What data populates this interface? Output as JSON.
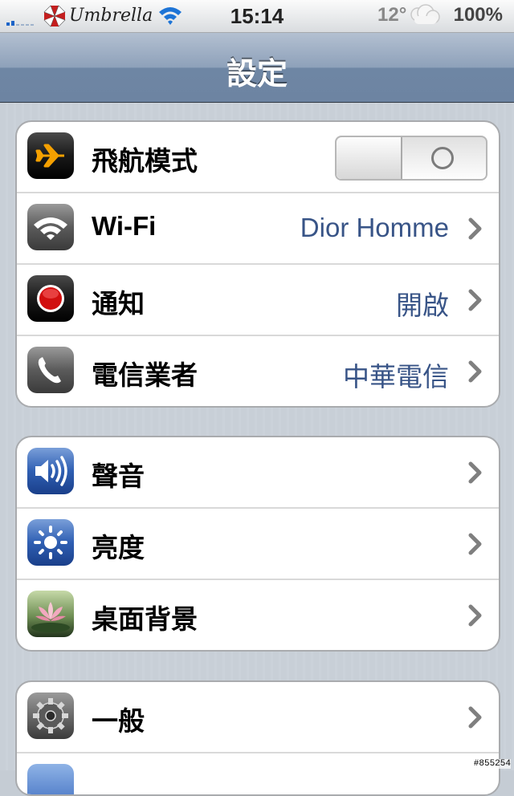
{
  "status_bar": {
    "carrier": "Umbrella",
    "time": "15:14",
    "temperature": "12°",
    "battery": "100%",
    "signal_bars": 2
  },
  "nav": {
    "title": "設定"
  },
  "groups": [
    {
      "rows": [
        {
          "icon": "airplane-icon",
          "label": "飛航模式",
          "toggle_state": "off"
        },
        {
          "icon": "wifi-icon",
          "label": "Wi-Fi",
          "value": "Dior Homme"
        },
        {
          "icon": "notification-icon",
          "label": "通知",
          "value": "開啟"
        },
        {
          "icon": "phone-icon",
          "label": "電信業者",
          "value": "中華電信"
        }
      ]
    },
    {
      "rows": [
        {
          "icon": "speaker-icon",
          "label": "聲音"
        },
        {
          "icon": "brightness-icon",
          "label": "亮度"
        },
        {
          "icon": "wallpaper-icon",
          "label": "桌面背景"
        }
      ]
    },
    {
      "rows": [
        {
          "icon": "gear-icon",
          "label": "一般"
        }
      ]
    }
  ],
  "watermark": "#855254"
}
